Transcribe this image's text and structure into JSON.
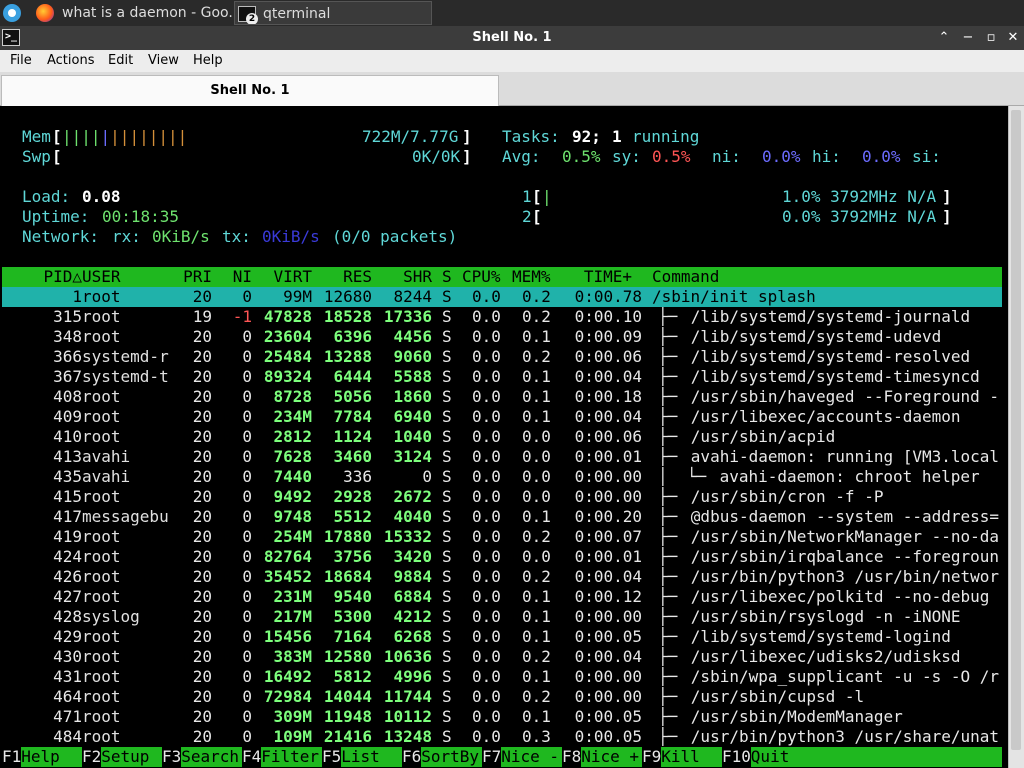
{
  "taskbar": {
    "tasks": [
      {
        "label": "what is a daemon - Goo..."
      },
      {
        "label": "qterminal",
        "badge": "2"
      }
    ]
  },
  "window": {
    "title": "Shell No. 1",
    "buttons": {
      "up": "⌃",
      "minimize": "−",
      "maximize": "▫",
      "close": "✕"
    }
  },
  "menu": [
    "File",
    "Actions",
    "Edit",
    "View",
    "Help"
  ],
  "tab": {
    "label": "Shell No. 1"
  },
  "htop": {
    "mem_label": "Mem",
    "mem_value": "722M/7.77G",
    "swp_label": "Swp",
    "swp_value": "0K/0K",
    "tasks_label": "Tasks:",
    "tasks_count": "92;",
    "running_count": "1",
    "running_label": "running",
    "avg_label": "Avg:",
    "avg_us": "0.5%",
    "sy_label": "sy:",
    "avg_sy": "0.5%",
    "ni_label": "ni:",
    "avg_ni": "0.0%",
    "hi_label": "hi:",
    "avg_hi": "0.0%",
    "si_label": "si:",
    "load_label": "Load:",
    "load_value": "0.08",
    "uptime_label": "Uptime:",
    "uptime_value": "00:18:35",
    "network_label": "Network:",
    "rx_label": "rx:",
    "rx_value": "0KiB/s",
    "tx_label": "tx:",
    "tx_value": "0KiB/s",
    "packets": "(0/0 packets)",
    "cpu1_label": "1",
    "cpu1_value": "1.0% 3792MHz N/A",
    "cpu2_label": "2",
    "cpu2_value": "0.0% 3792MHz N/A",
    "columns": [
      "PID△",
      "USER",
      "PRI",
      "NI",
      "VIRT",
      "RES",
      "SHR",
      "S",
      "CPU%",
      "MEM%",
      "TIME+",
      "Command"
    ],
    "processes": [
      {
        "pid": "1",
        "user": "root",
        "pri": "20",
        "ni": "0",
        "virt": "99M",
        "res": "12680",
        "shr": "8244",
        "s": "S",
        "cpu": "0.0",
        "mem": "0.2",
        "time": "0:00.78",
        "tree": "",
        "cmd": "/sbin/init splash"
      },
      {
        "pid": "315",
        "user": "root",
        "pri": "19",
        "ni": "-1",
        "virt": "47828",
        "res": "18528",
        "shr": "17336",
        "s": "S",
        "cpu": "0.0",
        "mem": "0.2",
        "time": "0:00.10",
        "tree": "├─ ",
        "cmd": "/lib/systemd/systemd-journald"
      },
      {
        "pid": "348",
        "user": "root",
        "pri": "20",
        "ni": "0",
        "virt": "23604",
        "res": "6396",
        "shr": "4456",
        "s": "S",
        "cpu": "0.0",
        "mem": "0.1",
        "time": "0:00.09",
        "tree": "├─ ",
        "cmd": "/lib/systemd/systemd-udevd"
      },
      {
        "pid": "366",
        "user": "systemd-r",
        "pri": "20",
        "ni": "0",
        "virt": "25484",
        "res": "13288",
        "shr": "9060",
        "s": "S",
        "cpu": "0.0",
        "mem": "0.2",
        "time": "0:00.06",
        "tree": "├─ ",
        "cmd": "/lib/systemd/systemd-resolved"
      },
      {
        "pid": "367",
        "user": "systemd-t",
        "pri": "20",
        "ni": "0",
        "virt": "89324",
        "res": "6444",
        "shr": "5588",
        "s": "S",
        "cpu": "0.0",
        "mem": "0.1",
        "time": "0:00.04",
        "tree": "├─ ",
        "cmd": "/lib/systemd/systemd-timesyncd"
      },
      {
        "pid": "408",
        "user": "root",
        "pri": "20",
        "ni": "0",
        "virt": "8728",
        "res": "5056",
        "shr": "1860",
        "s": "S",
        "cpu": "0.0",
        "mem": "0.1",
        "time": "0:00.18",
        "tree": "├─ ",
        "cmd": "/usr/sbin/haveged --Foreground -"
      },
      {
        "pid": "409",
        "user": "root",
        "pri": "20",
        "ni": "0",
        "virt": "234M",
        "res": "7784",
        "shr": "6940",
        "s": "S",
        "cpu": "0.0",
        "mem": "0.1",
        "time": "0:00.04",
        "tree": "├─ ",
        "cmd": "/usr/libexec/accounts-daemon"
      },
      {
        "pid": "410",
        "user": "root",
        "pri": "20",
        "ni": "0",
        "virt": "2812",
        "res": "1124",
        "shr": "1040",
        "s": "S",
        "cpu": "0.0",
        "mem": "0.0",
        "time": "0:00.06",
        "tree": "├─ ",
        "cmd": "/usr/sbin/acpid"
      },
      {
        "pid": "413",
        "user": "avahi",
        "pri": "20",
        "ni": "0",
        "virt": "7628",
        "res": "3460",
        "shr": "3124",
        "s": "S",
        "cpu": "0.0",
        "mem": "0.0",
        "time": "0:00.01",
        "tree": "├─ ",
        "cmd": "avahi-daemon: running [VM3.local"
      },
      {
        "pid": "435",
        "user": "avahi",
        "pri": "20",
        "ni": "0",
        "virt": "7440",
        "res": "336",
        "shr": "0",
        "s": "S",
        "cpu": "0.0",
        "mem": "0.0",
        "time": "0:00.00",
        "tree": "│  └─ ",
        "cmd": "avahi-daemon: chroot helper"
      },
      {
        "pid": "415",
        "user": "root",
        "pri": "20",
        "ni": "0",
        "virt": "9492",
        "res": "2928",
        "shr": "2672",
        "s": "S",
        "cpu": "0.0",
        "mem": "0.0",
        "time": "0:00.00",
        "tree": "├─ ",
        "cmd": "/usr/sbin/cron -f -P"
      },
      {
        "pid": "417",
        "user": "messagebu",
        "pri": "20",
        "ni": "0",
        "virt": "9748",
        "res": "5512",
        "shr": "4040",
        "s": "S",
        "cpu": "0.0",
        "mem": "0.1",
        "time": "0:00.20",
        "tree": "├─ ",
        "cmd": "@dbus-daemon --system --address="
      },
      {
        "pid": "419",
        "user": "root",
        "pri": "20",
        "ni": "0",
        "virt": "254M",
        "res": "17880",
        "shr": "15332",
        "s": "S",
        "cpu": "0.0",
        "mem": "0.2",
        "time": "0:00.07",
        "tree": "├─ ",
        "cmd": "/usr/sbin/NetworkManager --no-da"
      },
      {
        "pid": "424",
        "user": "root",
        "pri": "20",
        "ni": "0",
        "virt": "82764",
        "res": "3756",
        "shr": "3420",
        "s": "S",
        "cpu": "0.0",
        "mem": "0.0",
        "time": "0:00.01",
        "tree": "├─ ",
        "cmd": "/usr/sbin/irqbalance --foregroun"
      },
      {
        "pid": "426",
        "user": "root",
        "pri": "20",
        "ni": "0",
        "virt": "35452",
        "res": "18684",
        "shr": "9884",
        "s": "S",
        "cpu": "0.0",
        "mem": "0.2",
        "time": "0:00.04",
        "tree": "├─ ",
        "cmd": "/usr/bin/python3 /usr/bin/networ"
      },
      {
        "pid": "427",
        "user": "root",
        "pri": "20",
        "ni": "0",
        "virt": "231M",
        "res": "9540",
        "shr": "6884",
        "s": "S",
        "cpu": "0.0",
        "mem": "0.1",
        "time": "0:00.12",
        "tree": "├─ ",
        "cmd": "/usr/libexec/polkitd --no-debug"
      },
      {
        "pid": "428",
        "user": "syslog",
        "pri": "20",
        "ni": "0",
        "virt": "217M",
        "res": "5300",
        "shr": "4212",
        "s": "S",
        "cpu": "0.0",
        "mem": "0.1",
        "time": "0:00.00",
        "tree": "├─ ",
        "cmd": "/usr/sbin/rsyslogd -n -iNONE"
      },
      {
        "pid": "429",
        "user": "root",
        "pri": "20",
        "ni": "0",
        "virt": "15456",
        "res": "7164",
        "shr": "6268",
        "s": "S",
        "cpu": "0.0",
        "mem": "0.1",
        "time": "0:00.05",
        "tree": "├─ ",
        "cmd": "/lib/systemd/systemd-logind"
      },
      {
        "pid": "430",
        "user": "root",
        "pri": "20",
        "ni": "0",
        "virt": "383M",
        "res": "12580",
        "shr": "10636",
        "s": "S",
        "cpu": "0.0",
        "mem": "0.2",
        "time": "0:00.04",
        "tree": "├─ ",
        "cmd": "/usr/libexec/udisks2/udisksd"
      },
      {
        "pid": "431",
        "user": "root",
        "pri": "20",
        "ni": "0",
        "virt": "16492",
        "res": "5812",
        "shr": "4996",
        "s": "S",
        "cpu": "0.0",
        "mem": "0.1",
        "time": "0:00.00",
        "tree": "├─ ",
        "cmd": "/sbin/wpa_supplicant -u -s -O /r"
      },
      {
        "pid": "464",
        "user": "root",
        "pri": "20",
        "ni": "0",
        "virt": "72984",
        "res": "14044",
        "shr": "11744",
        "s": "S",
        "cpu": "0.0",
        "mem": "0.2",
        "time": "0:00.00",
        "tree": "├─ ",
        "cmd": "/usr/sbin/cupsd -l"
      },
      {
        "pid": "471",
        "user": "root",
        "pri": "20",
        "ni": "0",
        "virt": "309M",
        "res": "11948",
        "shr": "10112",
        "s": "S",
        "cpu": "0.0",
        "mem": "0.1",
        "time": "0:00.05",
        "tree": "├─ ",
        "cmd": "/usr/sbin/ModemManager"
      },
      {
        "pid": "484",
        "user": "root",
        "pri": "20",
        "ni": "0",
        "virt": "109M",
        "res": "21416",
        "shr": "13248",
        "s": "S",
        "cpu": "0.0",
        "mem": "0.3",
        "time": "0:00.05",
        "tree": "├─ ",
        "cmd": "/usr/bin/python3 /usr/share/unat"
      }
    ],
    "fkeys": [
      {
        "key": "F1",
        "label": "Help"
      },
      {
        "key": "F2",
        "label": "Setup"
      },
      {
        "key": "F3",
        "label": "Search"
      },
      {
        "key": "F4",
        "label": "Filter"
      },
      {
        "key": "F5",
        "label": "List"
      },
      {
        "key": "F6",
        "label": "SortBy"
      },
      {
        "key": "F7",
        "label": "Nice -"
      },
      {
        "key": "F8",
        "label": "Nice +"
      },
      {
        "key": "F9",
        "label": "Kill"
      },
      {
        "key": "F10",
        "label": "Quit"
      }
    ]
  }
}
